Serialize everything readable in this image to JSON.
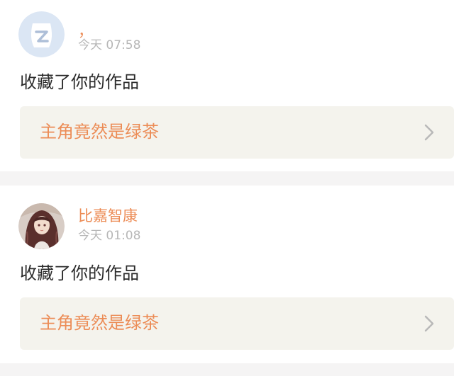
{
  "notifications": [
    {
      "username": "，",
      "timestamp": "今天 07:58",
      "action": "收藏了你的作品",
      "work_title": "主角竟然是绿茶",
      "avatar_icon": "qq-default-avatar-icon"
    },
    {
      "username": "比嘉智康",
      "timestamp": "今天 01:08",
      "action": "收藏了你的作品",
      "work_title": "主角竟然是绿茶",
      "avatar_icon": "anime-girl-avatar"
    }
  ],
  "colors": {
    "accent": "#ec8c56",
    "timestamp": "#b7b7b7",
    "card_link_bg": "#f4f3ed",
    "separator": "#f5f4f4"
  }
}
